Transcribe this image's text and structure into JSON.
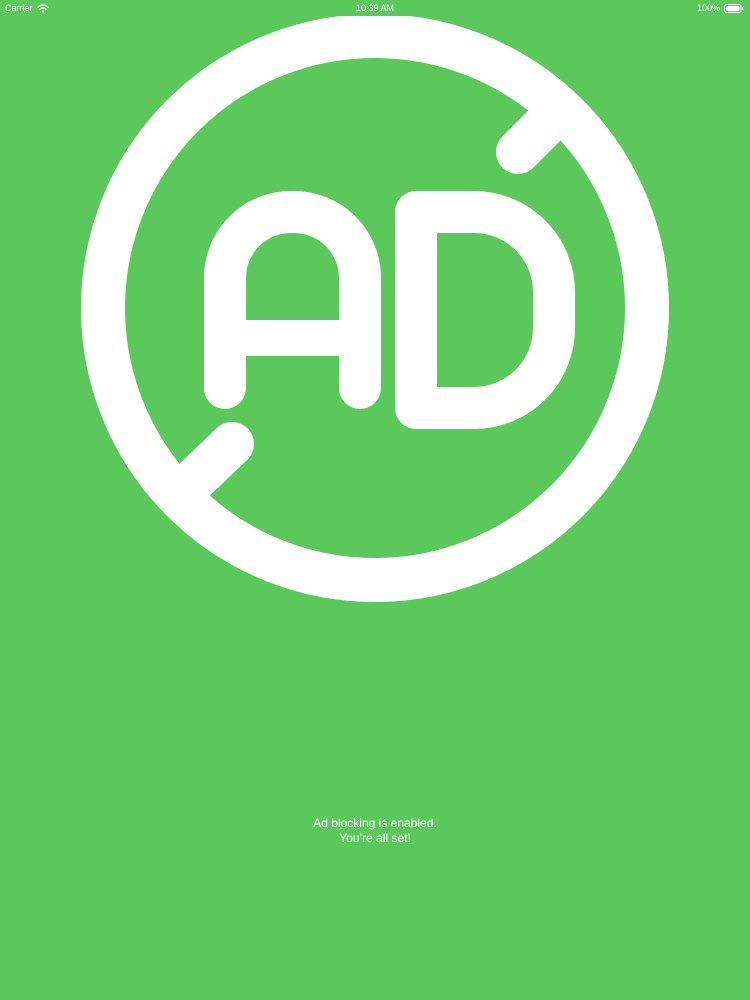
{
  "status_bar": {
    "carrier": "Carrier",
    "time": "10:39 AM",
    "battery": "100%",
    "icons": [
      "wifi-icon",
      "battery-icon"
    ]
  },
  "hero": {
    "icon": "ad-block-icon",
    "icon_text": "AD"
  },
  "message": {
    "line1": "Ad blocking is enabled.",
    "line2": "You’re all set!"
  },
  "colors": {
    "background": "#5ac85a",
    "foreground": "#ffffff"
  }
}
